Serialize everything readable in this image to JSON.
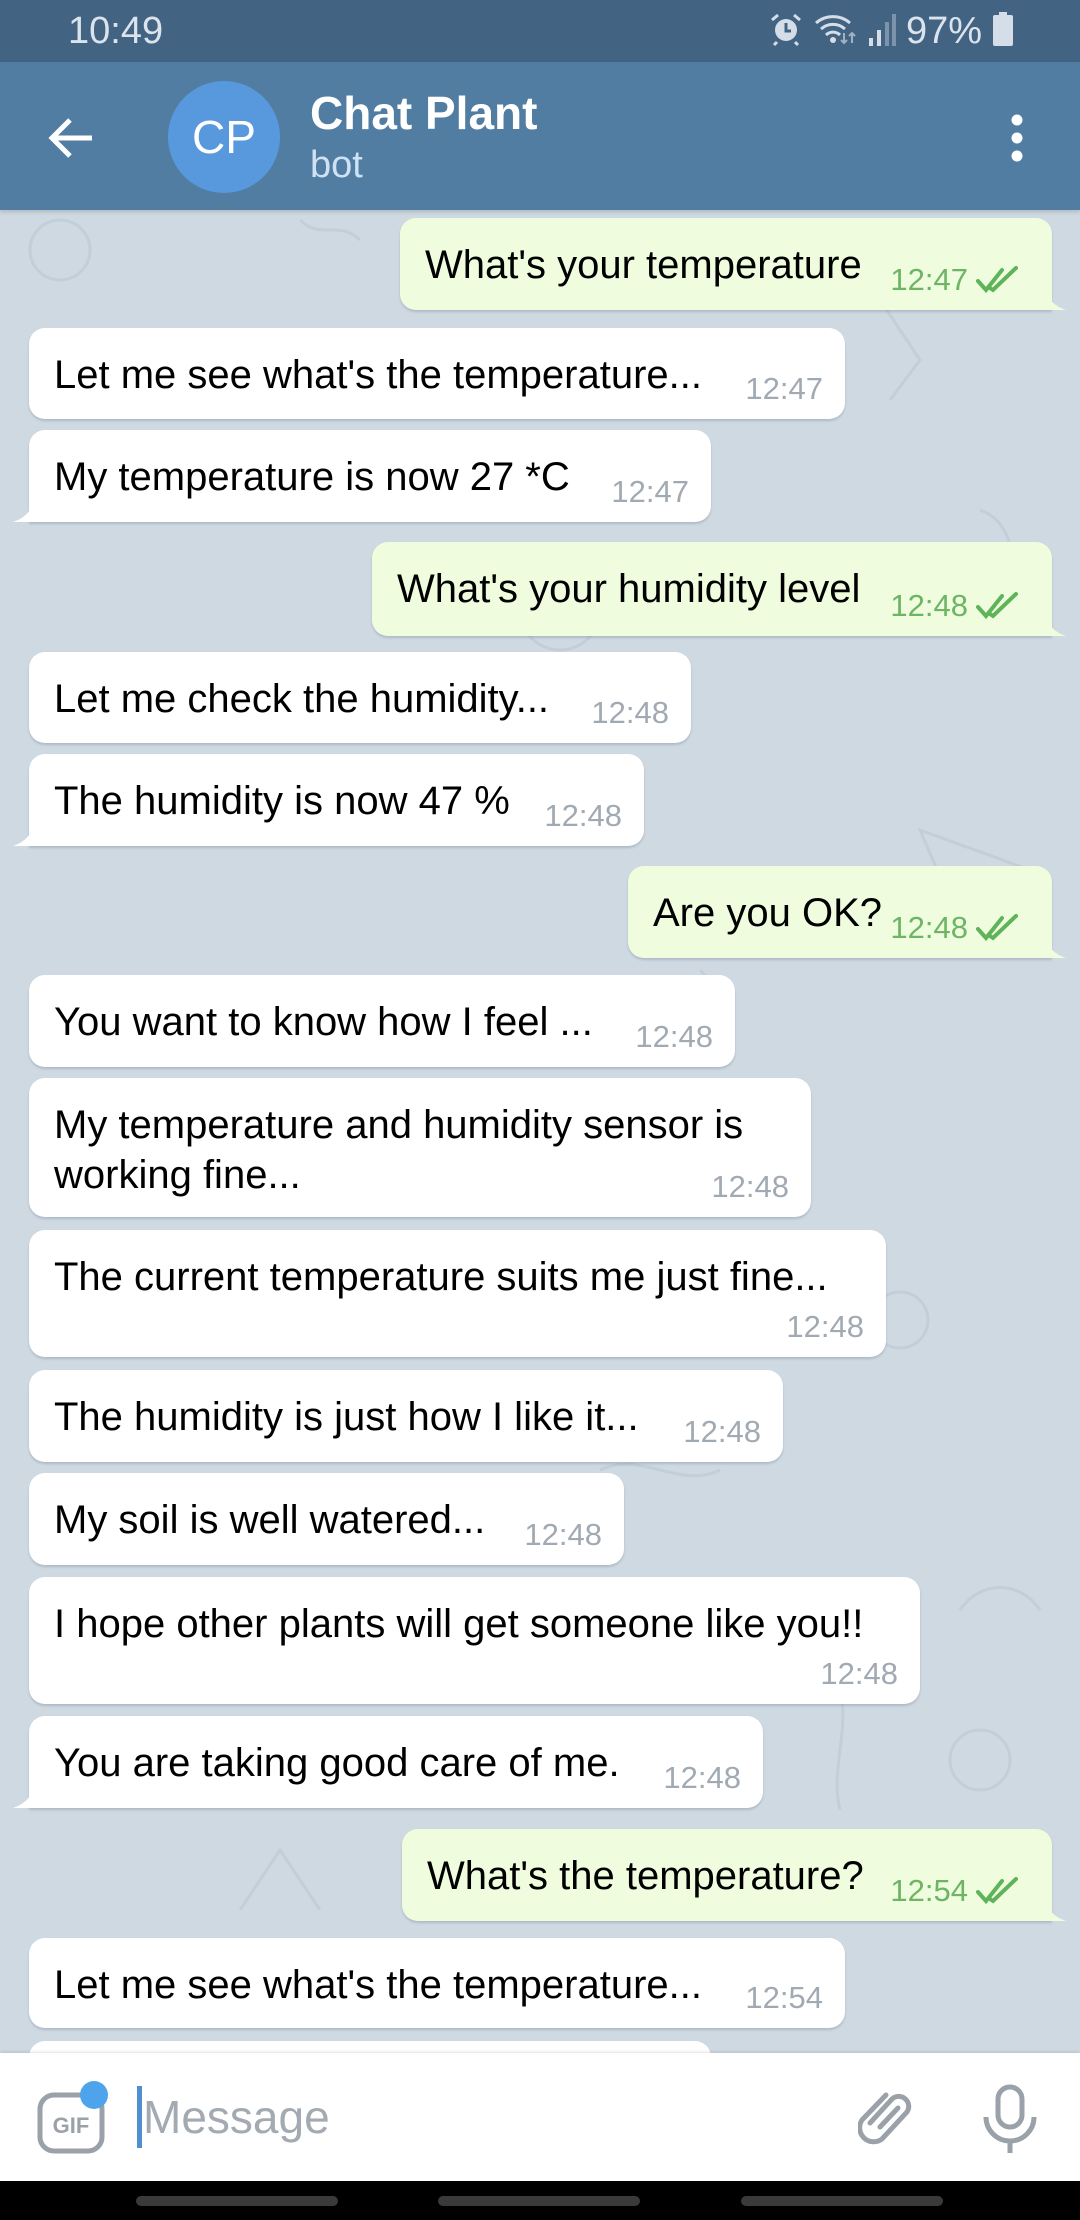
{
  "status_bar": {
    "time": "10:49",
    "battery_percent": "97%",
    "icons": [
      "alarm-icon",
      "wifi-icon",
      "signal-icon",
      "battery-icon"
    ]
  },
  "header": {
    "avatar_initials": "CP",
    "title": "Chat Plant",
    "subtitle": "bot",
    "back_icon": "arrow-left-icon",
    "menu_icon": "more-vertical-icon"
  },
  "colors": {
    "status_bar": "#436383",
    "toolbar": "#517da2",
    "avatar": "#5799dc",
    "outgoing_bubble": "#effdde",
    "incoming_bubble": "#ffffff",
    "outgoing_meta": "#6db565",
    "incoming_meta": "#a1aab3",
    "chat_background": "#cfd9e2"
  },
  "messages": [
    {
      "dir": "out",
      "text": "What's your temperature",
      "time": "12:47",
      "read": true
    },
    {
      "dir": "in",
      "text": "Let me see what's the temperature...",
      "time": "12:47"
    },
    {
      "dir": "in",
      "text": "My temperature is now 27 *C",
      "time": "12:47"
    },
    {
      "dir": "out",
      "text": "What's your humidity level",
      "time": "12:48",
      "read": true
    },
    {
      "dir": "in",
      "text": "Let me check the humidity...",
      "time": "12:48"
    },
    {
      "dir": "in",
      "text": "The humidity is now 47 %",
      "time": "12:48"
    },
    {
      "dir": "out",
      "text": "Are you OK?",
      "time": "12:48",
      "read": true
    },
    {
      "dir": "in",
      "text": "You want to know how I feel ...",
      "time": "12:48"
    },
    {
      "dir": "in",
      "text": "My temperature and humidity sensor is working fine...",
      "time": "12:48"
    },
    {
      "dir": "in",
      "text": "The current temperature suits me just fine...",
      "time": "12:48"
    },
    {
      "dir": "in",
      "text": "The humidity is just how I like it...",
      "time": "12:48"
    },
    {
      "dir": "in",
      "text": "My soil is well watered...",
      "time": "12:48"
    },
    {
      "dir": "in",
      "text": "I hope other plants will get someone like you!!",
      "time": "12:48"
    },
    {
      "dir": "in",
      "text": "You are taking good care of me.",
      "time": "12:48"
    },
    {
      "dir": "out",
      "text": "What's the temperature?",
      "time": "12:54",
      "read": true
    },
    {
      "dir": "in",
      "text": "Let me see what's the temperature...",
      "time": "12:54"
    },
    {
      "dir": "in",
      "text": "",
      "time": ""
    }
  ],
  "input": {
    "placeholder": "Message",
    "value": "",
    "gif_label": "GIF",
    "attach_icon": "paperclip-icon",
    "mic_icon": "microphone-icon"
  }
}
